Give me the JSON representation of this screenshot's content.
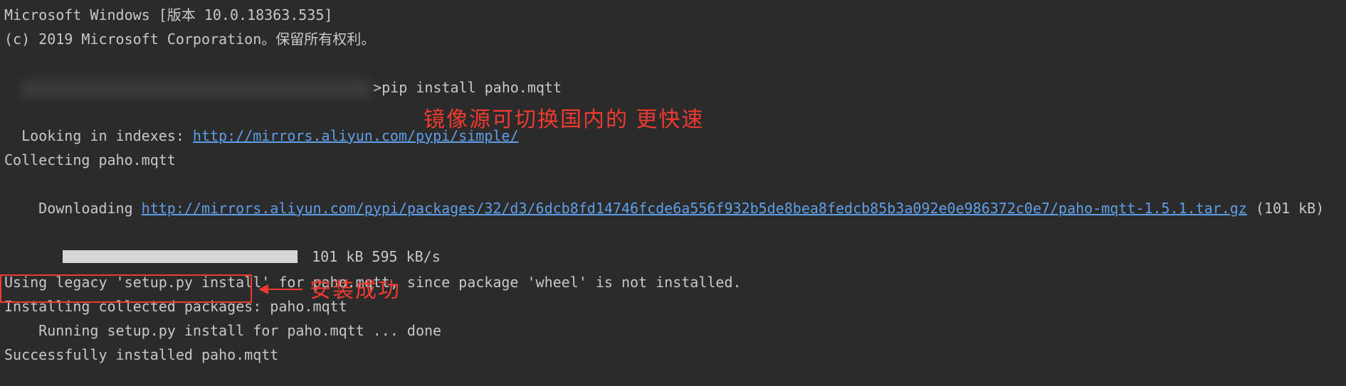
{
  "terminal": {
    "version_line": "Microsoft Windows [版本 10.0.18363.535]",
    "copyright_line": "(c) 2019 Microsoft Corporation。保留所有权利。",
    "blank1": "",
    "prompt_suffix": ">pip install paho.mqtt",
    "indexes_prefix": "Looking in indexes: ",
    "indexes_url": "http://mirrors.aliyun.com/pypi/simple/",
    "collecting": "Collecting paho.mqtt",
    "download_prefix": "  Downloading ",
    "download_url": "http://mirrors.aliyun.com/pypi/packages/32/d3/6dcb8fd14746fcde6a556f932b5de8bea8fedcb85b3a092e0e986372c0e7/paho-mqtt-1.5.1.tar.gz",
    "download_size": " (101 kB)",
    "progress_text": " 101 kB 595 kB/s",
    "legacy_line": "Using legacy 'setup.py install' for paho.mqtt, since package 'wheel' is not installed.",
    "installing_line": "Installing collected packages: paho.mqtt",
    "running_line": "    Running setup.py install for paho.mqtt ... done",
    "success_line": "Successfully installed paho.mqtt"
  },
  "annotations": {
    "mirror_note": "镜像源可切换国内的 更快速",
    "success_note": "安装成功"
  }
}
